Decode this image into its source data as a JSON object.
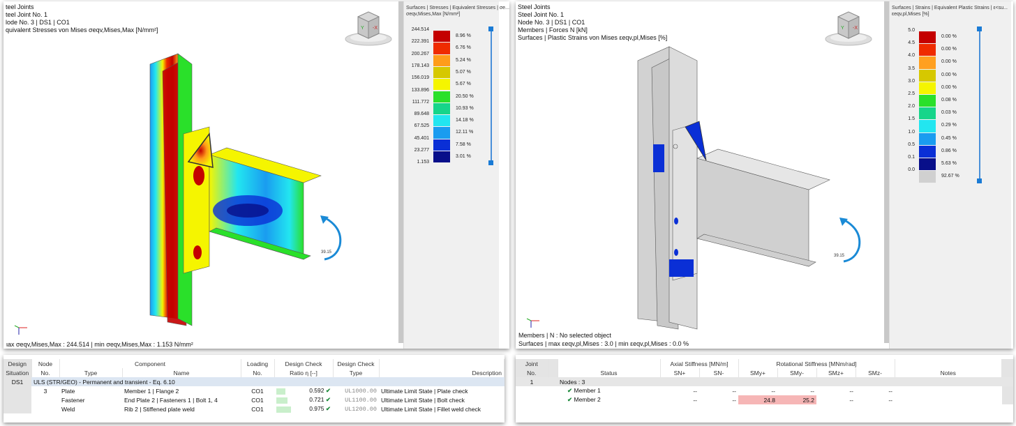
{
  "left_view": {
    "header": [
      "teel Joints",
      "teel Joint No. 1",
      "lode No. 3 | DS1 | CO1",
      "quivalent Stresses von Mises σeqv,Mises,Max [N/mm²]"
    ],
    "footer": "ιax σeqv,Mises,Max : 244.514 | min σeqv,Mises,Max : 1.153 N/mm²",
    "rotation_label": "39.15",
    "legend": {
      "title1": "Surfaces | Stresses | Equivalent Stresses | σe...",
      "title2": "σeqv,Mises,Max [N/mm²]",
      "values": [
        "244.514",
        "222.391",
        "200.267",
        "178.143",
        "156.019",
        "133.896",
        "111.772",
        "89.648",
        "67.525",
        "45.401",
        "23.277",
        "1.153"
      ],
      "percents": [
        "8.96 %",
        "6.76 %",
        "5.24 %",
        "5.07 %",
        "5.67 %",
        "20.50 %",
        "10.93 %",
        "14.18 %",
        "12.11 %",
        "7.58 %",
        "3.01 %"
      ],
      "colors": [
        "#c40000",
        "#ef2b00",
        "#ff9c1a",
        "#d6c800",
        "#f5f500",
        "#2ae02a",
        "#16d58a",
        "#22e6f0",
        "#1a9cf0",
        "#0a2fd6",
        "#080f8a"
      ]
    }
  },
  "right_view": {
    "header": [
      "Steel Joints",
      "Steel Joint No. 1",
      "Node No. 3 | DS1 | CO1",
      "Members | Forces N [kN]",
      "Surfaces | Plastic Strains von Mises εeqv,pl,Mises [%]"
    ],
    "footer": [
      "Members | N : No selected object",
      "Surfaces | max εeqv,pl,Mises : 3.0 | min εeqv,pl,Mises : 0.0 %"
    ],
    "rotation_label": "39.15",
    "legend": {
      "title1": "Surfaces | Strains | Equivalent Plastic Strains | ε<su...",
      "title2": "εeqv,pl,Mises [%]",
      "values": [
        "5.0",
        "4.5",
        "4.0",
        "3.5",
        "3.0",
        "2.5",
        "2.0",
        "1.5",
        "1.0",
        "0.5",
        "0.1",
        "0.0"
      ],
      "percents": [
        "0.00 %",
        "0.00 %",
        "0.00 %",
        "0.00 %",
        "0.00 %",
        "0.08 %",
        "0.03 %",
        "0.29 %",
        "0.45 %",
        "0.86 %",
        "5.63 %",
        "92.67 %"
      ],
      "colors": [
        "#c40000",
        "#ef2b00",
        "#ffa020",
        "#d6c800",
        "#f5f500",
        "#2ae02a",
        "#16d58a",
        "#22e6f0",
        "#1a9cf0",
        "#0a2fd6",
        "#080f8a",
        "#d0d0d0"
      ]
    }
  },
  "left_table": {
    "headers": {
      "design_situation": "Design",
      "design_situation2": "Situation",
      "node": "Node",
      "node2": "No.",
      "component": "Component",
      "type": "Type",
      "name": "Name",
      "loading": "Loading",
      "loading2": "No.",
      "check_ratio": "Design Check",
      "check_ratio2": "Ratio η [--]",
      "check_type": "Design Check",
      "check_type2": "Type",
      "description": "Description"
    },
    "group_ds": "DS1",
    "group_label": "ULS (STR/GEO) - Permanent and transient - Eq. 6.10",
    "node_no": "3",
    "rows": [
      {
        "type": "Plate",
        "name": "Member 1 | Flange 2",
        "loading": "CO1",
        "ratio": "0.592",
        "ratio_val": 0.592,
        "check": "UL1000.00",
        "desc": "Ultimate Limit State | Plate check"
      },
      {
        "type": "Fastener",
        "name": "End Plate 2 | Fasteners 1 | Bolt 1, 4",
        "loading": "CO1",
        "ratio": "0.721",
        "ratio_val": 0.721,
        "check": "UL1100.00",
        "desc": "Ultimate Limit State | Bolt check"
      },
      {
        "type": "Weld",
        "name": "Rib 2 | Stiffened plate weld",
        "loading": "CO1",
        "ratio": "0.975",
        "ratio_val": 0.975,
        "check": "UL1200.00",
        "desc": "Ultimate Limit State | Fillet weld check"
      }
    ]
  },
  "right_table": {
    "headers": {
      "joint": "Joint",
      "joint2": "No.",
      "status": "Status",
      "axial": "Axial Stiffness [MN/m]",
      "rotational": "Rotational Stiffness [MNm/rad]",
      "sn_plus": "SN+",
      "sn_minus": "SN-",
      "smy_plus": "SMy+",
      "smy_minus": "SMy-",
      "smz_plus": "SMz+",
      "smz_minus": "SMz-",
      "notes": "Notes"
    },
    "joint_no": "1",
    "nodes_label": "Nodes : 3",
    "rows": [
      {
        "status": "Member 1",
        "sn_plus": "--",
        "sn_minus": "--",
        "smy_plus": "--",
        "smy_minus": "--",
        "smz_plus": "--",
        "smz_minus": "--"
      },
      {
        "status": "Member 2",
        "sn_plus": "--",
        "sn_minus": "--",
        "smy_plus": "24.8",
        "smy_minus": "25.2",
        "smz_plus": "--",
        "smz_minus": "--"
      }
    ]
  }
}
